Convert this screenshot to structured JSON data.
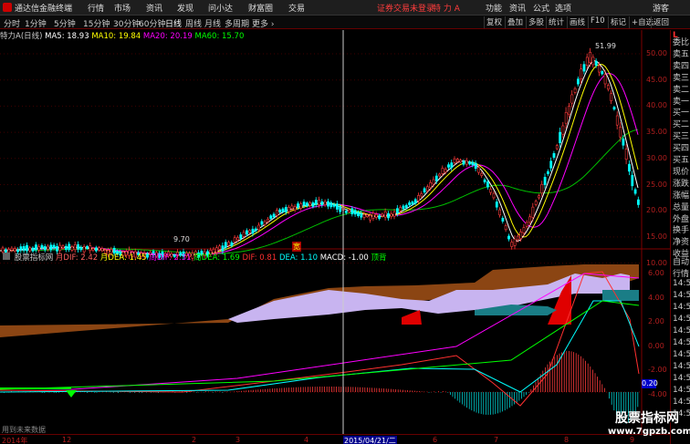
{
  "titlebar": {
    "app_name": "通达信金融终端",
    "menus": [
      "行情",
      "市场",
      "资讯",
      "发现",
      "问小达",
      "财富圈",
      "交易"
    ],
    "login_notice": "证券交易未登录",
    "stock_name": "特 力 A",
    "right_items": [
      "功能",
      "资讯",
      "公式",
      "选项"
    ],
    "user": "游客"
  },
  "periodbar": {
    "periods": [
      "分时",
      "1分钟",
      "5分钟",
      "15分钟",
      "30分钟",
      "60分钟",
      "日线",
      "周线",
      "月线",
      "多周期",
      "更多 ›"
    ],
    "active_period": "日线",
    "tools": [
      "复权",
      "叠加",
      "多股",
      "统计",
      "画线",
      "F10",
      "标记",
      "+自选",
      "返回"
    ]
  },
  "ma_legend": {
    "title": "特力A(日线)",
    "items": [
      {
        "label": "MA5: 18.93",
        "color": "#ffffff"
      },
      {
        "label": "MA10: 19.84",
        "color": "#ffff00"
      },
      {
        "label": "MA20: 20.19",
        "color": "#ff00ff"
      },
      {
        "label": "MA60: 15.70",
        "color": "#00ff00"
      }
    ]
  },
  "right_panel": {
    "top_label": "L",
    "items": [
      "委比",
      "卖五",
      "卖四",
      "卖三",
      "卖二",
      "卖一",
      "买一",
      "买二",
      "买三",
      "买四",
      "买五",
      "现价",
      "涨跌",
      "涨幅",
      "总量",
      "外盘",
      "换手",
      "净资",
      "收益"
    ],
    "lower_items": [
      "自动",
      "行情",
      "14:5",
      "14:5",
      "14:5",
      "14:5",
      "14:5",
      "14:5",
      "14:5",
      "14:5",
      "14:5",
      "14:5",
      "14:5",
      "14:5"
    ]
  },
  "price_axis": {
    "ticks": [
      "50.00",
      "45.00",
      "40.00",
      "35.00",
      "30.00",
      "25.00",
      "20.00",
      "15.00",
      "10.00"
    ],
    "max_label": "51.99",
    "min_label": "9.70"
  },
  "indicator": {
    "name": "股票指标网",
    "legend": [
      {
        "label": "月DIF: 2.42",
        "color": "#ff6060"
      },
      {
        "label": "月DEA: 1.45",
        "color": "#ffff00"
      },
      {
        "label": "周DIF: 2.31",
        "color": "#ff00ff"
      },
      {
        "label": "周DEA: 1.69",
        "color": "#00ff00"
      },
      {
        "label": "DIF: 0.81",
        "color": "#ff3030"
      },
      {
        "label": "DEA: 1.10",
        "color": "#00ffff"
      },
      {
        "label": "MACD: -1.00",
        "color": "#ffffff"
      },
      {
        "label": "顶背",
        "color": "#00ff00"
      }
    ],
    "axis_ticks": [
      "6.00",
      "4.00",
      "2.00",
      "0.00",
      "-2.00",
      "-4.00"
    ],
    "current_value": "0.20",
    "footer_note": "用到未来数据"
  },
  "marker_label": "宽",
  "timebar": {
    "ticks": [
      "2014年",
      "12",
      "2",
      "3",
      "4",
      "2015/04/21/二",
      "6",
      "7",
      "8",
      "9"
    ]
  },
  "watermark": {
    "title": "股票指标网",
    "url": "www.7gpzb.com"
  }
}
